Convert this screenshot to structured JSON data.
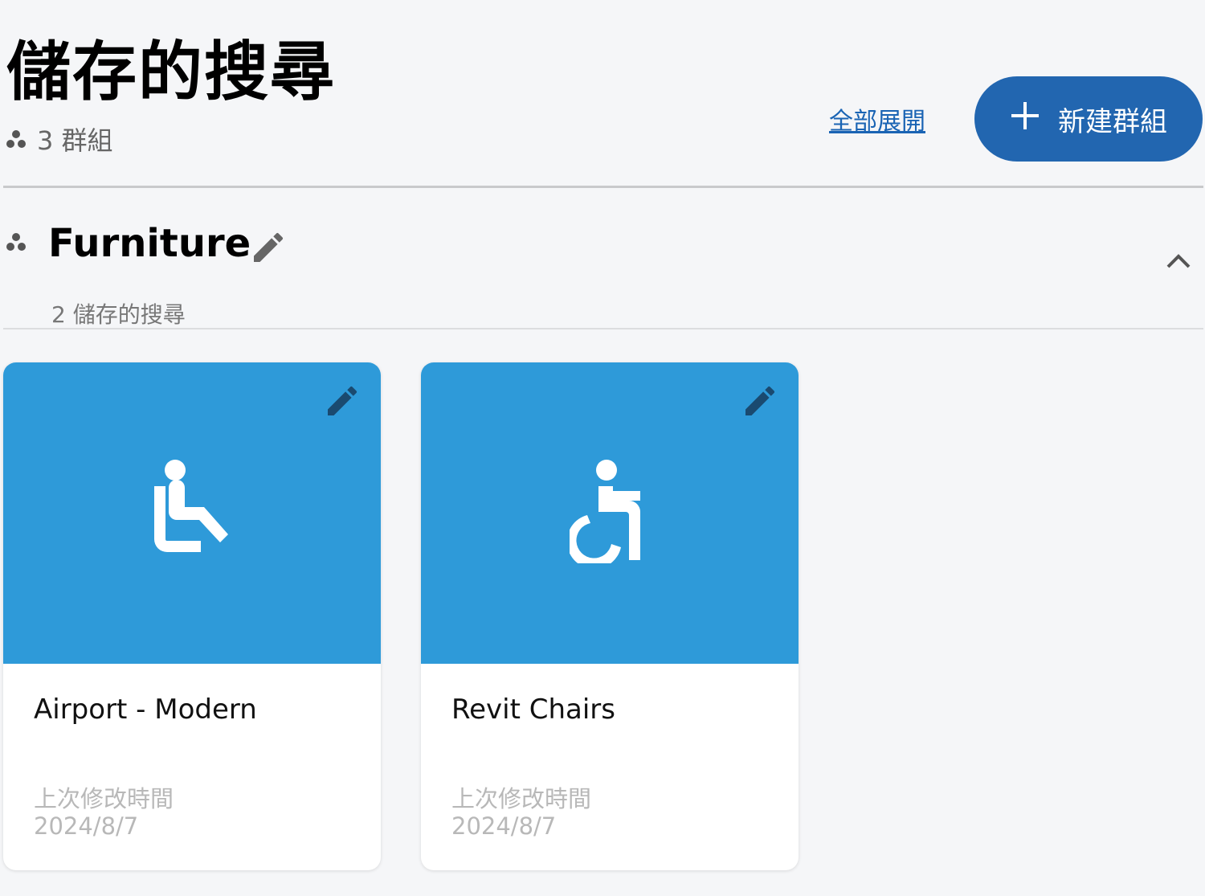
{
  "header": {
    "title": "儲存的搜尋",
    "group_count_text": "3 群組",
    "group_icon": "group-dots-icon",
    "expand_all_label": "全部展開",
    "new_group_label": "新建群組",
    "new_group_icon": "plus-icon",
    "button_color": "#2266b0",
    "link_color": "#1a64b4"
  },
  "group": {
    "name": "Furniture",
    "subcount_text": "2 儲存的搜尋",
    "edit_icon": "pencil-icon",
    "collapse_icon": "chevron-up-icon"
  },
  "cards": [
    {
      "title": "Airport - Modern",
      "meta_label": "上次修改時間",
      "meta_date": "2024/8/7",
      "icon": "seated-person-icon",
      "image_color": "#2e9ad9"
    },
    {
      "title": "Revit Chairs",
      "meta_label": "上次修改時間",
      "meta_date": "2024/8/7",
      "icon": "wheelchair-icon",
      "image_color": "#2e9ad9"
    }
  ]
}
